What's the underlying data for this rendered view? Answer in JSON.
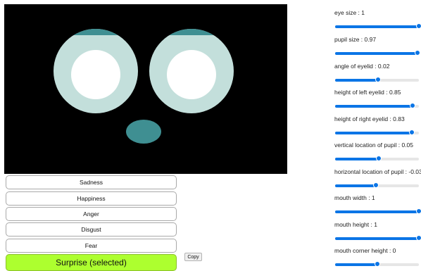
{
  "face": {
    "colors": {
      "background": "#000000",
      "eye_white": "#c3dfdb",
      "pupil": "#ffffff",
      "eyelid": "#3f8f92",
      "mouth": "#3f8f92"
    }
  },
  "emotions": [
    {
      "label": "Sadness",
      "selected": false
    },
    {
      "label": "Happiness",
      "selected": false
    },
    {
      "label": "Anger",
      "selected": false
    },
    {
      "label": "Disgust",
      "selected": false
    },
    {
      "label": "Fear",
      "selected": false
    },
    {
      "label": "Surprise (selected)",
      "selected": true
    }
  ],
  "copy_button": {
    "label": "Copy"
  },
  "sliders": [
    {
      "label": "eye size : 1",
      "min": -1,
      "max": 1,
      "value": 1
    },
    {
      "label": "pupil size : 0.97",
      "min": -1,
      "max": 1,
      "value": 0.97
    },
    {
      "label": "angle of eyelid : 0.02",
      "min": -1,
      "max": 1,
      "value": 0.02
    },
    {
      "label": "height of left eyelid : 0.85",
      "min": -1,
      "max": 1,
      "value": 0.85
    },
    {
      "label": "height of right eyelid : 0.83",
      "min": -1,
      "max": 1,
      "value": 0.83
    },
    {
      "label": "vertical location of pupil : 0.05",
      "min": -1,
      "max": 1,
      "value": 0.05
    },
    {
      "label": "horizontal location of pupil : -0.03",
      "min": -1,
      "max": 1,
      "value": -0.03
    },
    {
      "label": "mouth width : 1",
      "min": -1,
      "max": 1,
      "value": 1
    },
    {
      "label": "mouth height : 1",
      "min": -1,
      "max": 1,
      "value": 1
    },
    {
      "label": "mouth corner height : 0",
      "min": -1,
      "max": 1,
      "value": 0
    }
  ],
  "accent_color": "#0b75e6",
  "selected_color": "#adff2f"
}
